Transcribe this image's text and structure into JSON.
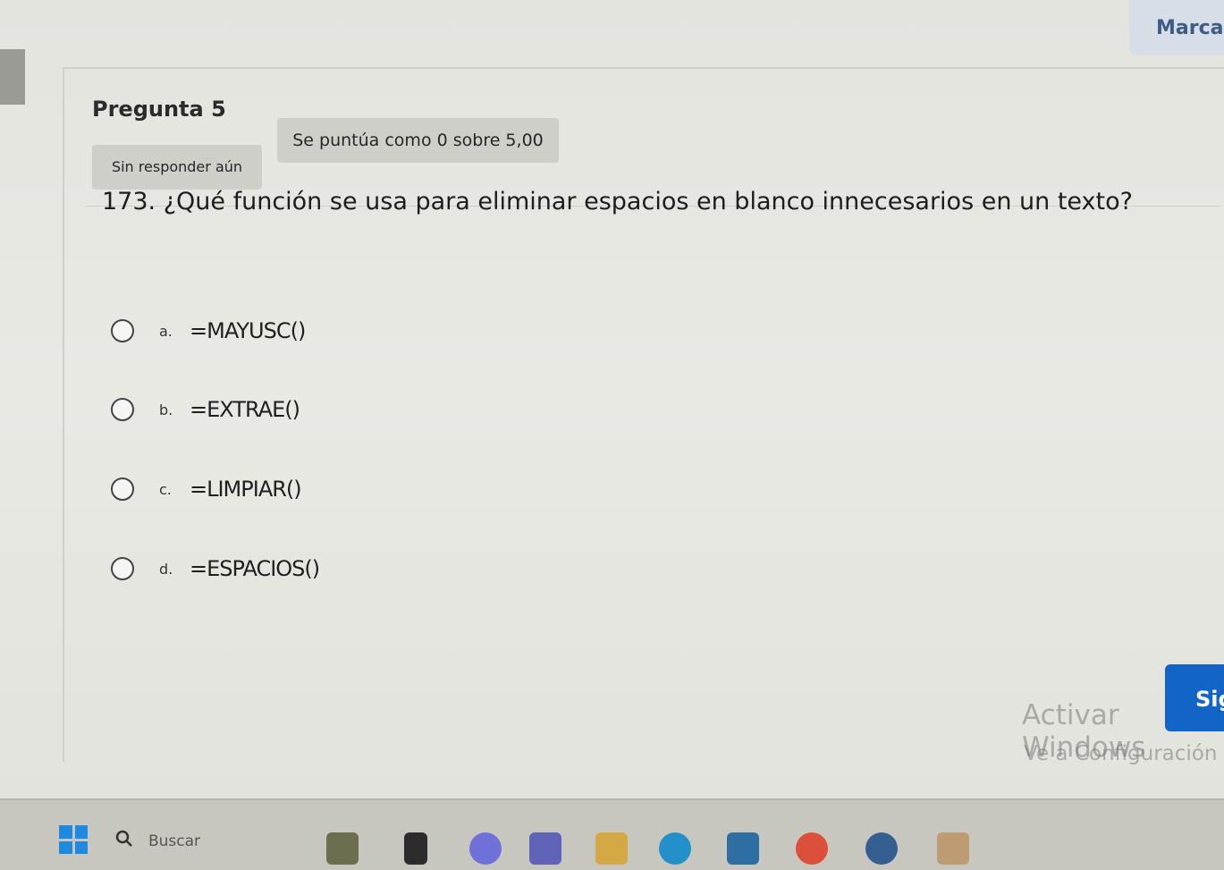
{
  "header": {
    "mark_label": "Marca"
  },
  "question_card": {
    "title": "Pregunta 5",
    "state_badge": "Sin responder aún",
    "grade_badge": "Se puntúa como 0 sobre 5,00",
    "question_text": "173. ¿Qué función se usa para eliminar espacios en blanco innecesarios en un texto?",
    "options": [
      {
        "letter": "a.",
        "text": "=MAYUSC()"
      },
      {
        "letter": "b.",
        "text": "=EXTRAE()"
      },
      {
        "letter": "c.",
        "text": "=LIMPIAR()"
      },
      {
        "letter": "d.",
        "text": "=ESPACIOS()"
      }
    ]
  },
  "overlay": {
    "watermark_title": "Activar Windows",
    "watermark_subtitle": "Ve a Configuración",
    "next_button_label": "Sig"
  },
  "taskbar": {
    "search_label": "Buscar",
    "colors": {
      "bar": "#c7c7c0",
      "accent_blue": "#1265c7"
    },
    "icons": [
      "windows-start-icon",
      "search-icon",
      "file-explorer-icon",
      "teams-icon",
      "chat-icon",
      "ms-teams-icon",
      "folder-icon",
      "edge-icon",
      "store-icon",
      "chrome-icon",
      "notification-icon",
      "app-icon"
    ]
  }
}
